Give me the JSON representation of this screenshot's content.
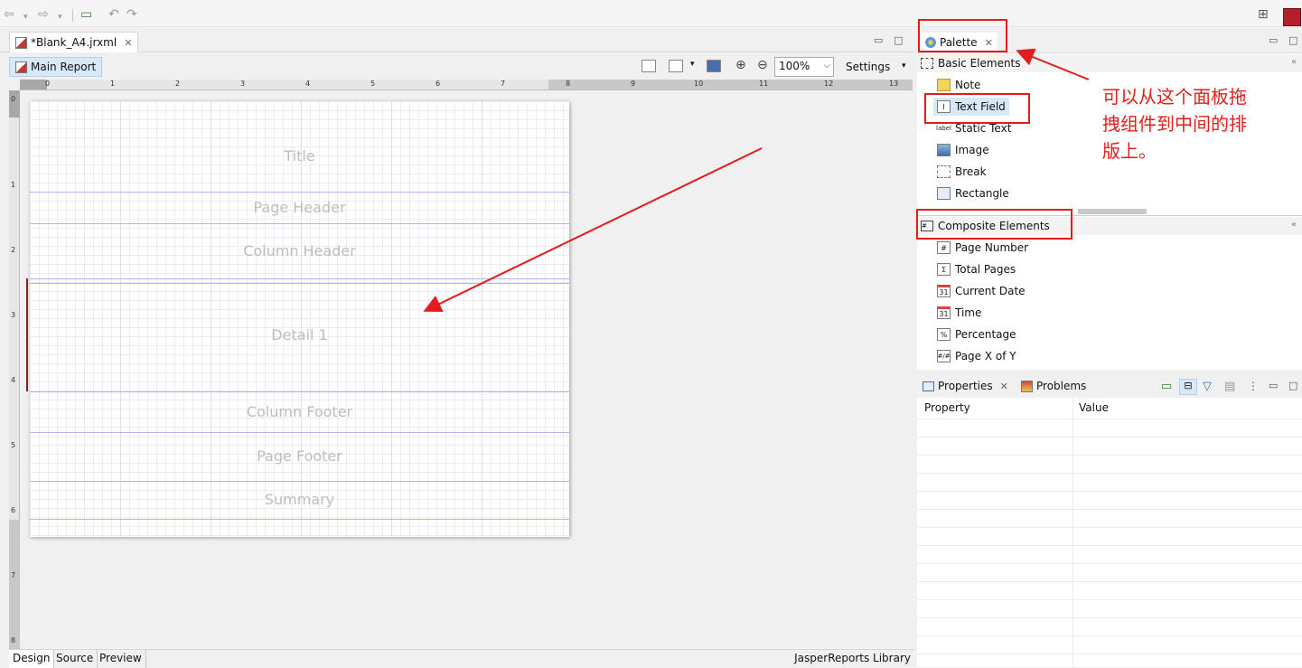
{
  "colors": {
    "annotation": "#e31c1c",
    "selection": "#d7e8f9",
    "band_line": "#b4b4e6"
  },
  "editor": {
    "tab_title": "*Blank_A4.jrxml",
    "main_report": "Main Report",
    "zoom": "100%",
    "settings": "Settings",
    "ruler_numbers": [
      "0",
      "1",
      "2",
      "3",
      "4",
      "5",
      "6",
      "7",
      "8",
      "9",
      "10",
      "11",
      "12",
      "13"
    ],
    "vruler_numbers": [
      "0",
      "1",
      "2",
      "3",
      "4",
      "5",
      "6",
      "7",
      "8"
    ],
    "bands": [
      "Title",
      "Page Header",
      "Column Header",
      "Detail 1",
      "Column Footer",
      "Page Footer",
      "Summary"
    ],
    "bottom_tabs": [
      "Design",
      "Source",
      "Preview"
    ],
    "library": "JasperReports Library"
  },
  "palette": {
    "title": "Palette",
    "basic_group": "Basic Elements",
    "basic_items": [
      {
        "label": "Note",
        "icon": "note-icon"
      },
      {
        "label": "Text Field",
        "icon": "text-field-icon"
      },
      {
        "label": "Static Text",
        "icon": "static-text-icon"
      },
      {
        "label": "Image",
        "icon": "image-icon"
      },
      {
        "label": "Break",
        "icon": "break-icon"
      },
      {
        "label": "Rectangle",
        "icon": "rectangle-icon"
      }
    ],
    "composite_group": "Composite Elements",
    "composite_items": [
      {
        "label": "Page Number",
        "icon": "hash-icon"
      },
      {
        "label": "Total Pages",
        "icon": "sigma-icon"
      },
      {
        "label": "Current Date",
        "icon": "calendar-icon"
      },
      {
        "label": "Time",
        "icon": "calendar-icon"
      },
      {
        "label": "Percentage",
        "icon": "percent-icon"
      },
      {
        "label": "Page X of Y",
        "icon": "page-x-of-y-icon"
      }
    ]
  },
  "properties": {
    "tab1": "Properties",
    "tab2": "Problems",
    "col_property": "Property",
    "col_value": "Value"
  },
  "annotation": {
    "note_lines": [
      "可以从这个面板拖",
      "拽组件到中间的排",
      "版上。"
    ]
  }
}
